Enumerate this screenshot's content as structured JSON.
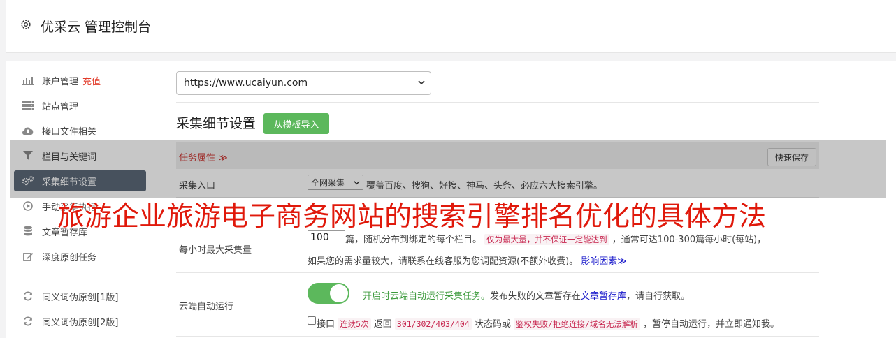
{
  "header": {
    "title": "优采云 管理控制台",
    "icon": "gear-icon"
  },
  "sidebar": {
    "items": [
      {
        "label": "账户管理",
        "badge": "充值",
        "icon": "bar-chart-icon"
      },
      {
        "label": "站点管理",
        "icon": "server-icon"
      },
      {
        "label": "接口文件相关",
        "icon": "cloud-upload-icon"
      },
      {
        "label": "栏目与关键词",
        "icon": "filter-icon"
      },
      {
        "label": "采集细节设置",
        "icon": "gears-icon",
        "active": true
      },
      {
        "label": "手动采集执行",
        "icon": "play-circle-icon"
      },
      {
        "label": "文章暂存库",
        "icon": "database-icon"
      },
      {
        "label": "深度原创任务",
        "icon": "edit-icon"
      },
      {
        "label": "同义词伪原创[1版]",
        "icon": "refresh-icon"
      },
      {
        "label": "同义词伪原创[2版]",
        "icon": "refresh-icon"
      }
    ]
  },
  "main": {
    "site_select": "https://www.ucaiyun.com",
    "section_title": "采集细节设置",
    "import_button": "从模板导入",
    "task_attr": "任务属性 ≫",
    "quick_save": "快速保存",
    "row_entry": {
      "label": "采集入口",
      "select_value": "全网采集",
      "desc": "覆盖百度、搜狗、好搜、神马、头条、必应六大搜索引擎。"
    },
    "row_rate": {
      "label": "每小时最大采集量",
      "value": "100",
      "text1": "篇，随机分布到绑定的每个栏目。",
      "code1": "仅为最大量，并不保证一定能达到",
      "text2": "，通常可达100-300篇每小时(每站)，",
      "text3": "如果您的需求量较大，请联系在线客服为您调配资源(不额外收费)。",
      "link": "影响因素≫"
    },
    "row_cloud": {
      "label": "云端自动运行",
      "on_text": "开启时云端自动运行采集任务。",
      "text1": "发布失败的文章暂存在",
      "link": "文章暂存库",
      "text2": "，请自行获取。",
      "check_label": "接口",
      "code1": "连续5次",
      "text3": "返回",
      "code2": "301/302/403/404",
      "text4": "状态码或",
      "code3": "鉴权失败/拒绝连接/域名无法解析",
      "text5": "，暂停自动运行，并立即通知我。"
    }
  },
  "overlay_headline": "旅游企业旅游电子商务网站的搜索引擎排名优化的具体方法",
  "colors": {
    "active_bg": "#5b6878",
    "green": "#5cb85c",
    "red": "#e0190b",
    "code_red": "#c7254e"
  }
}
